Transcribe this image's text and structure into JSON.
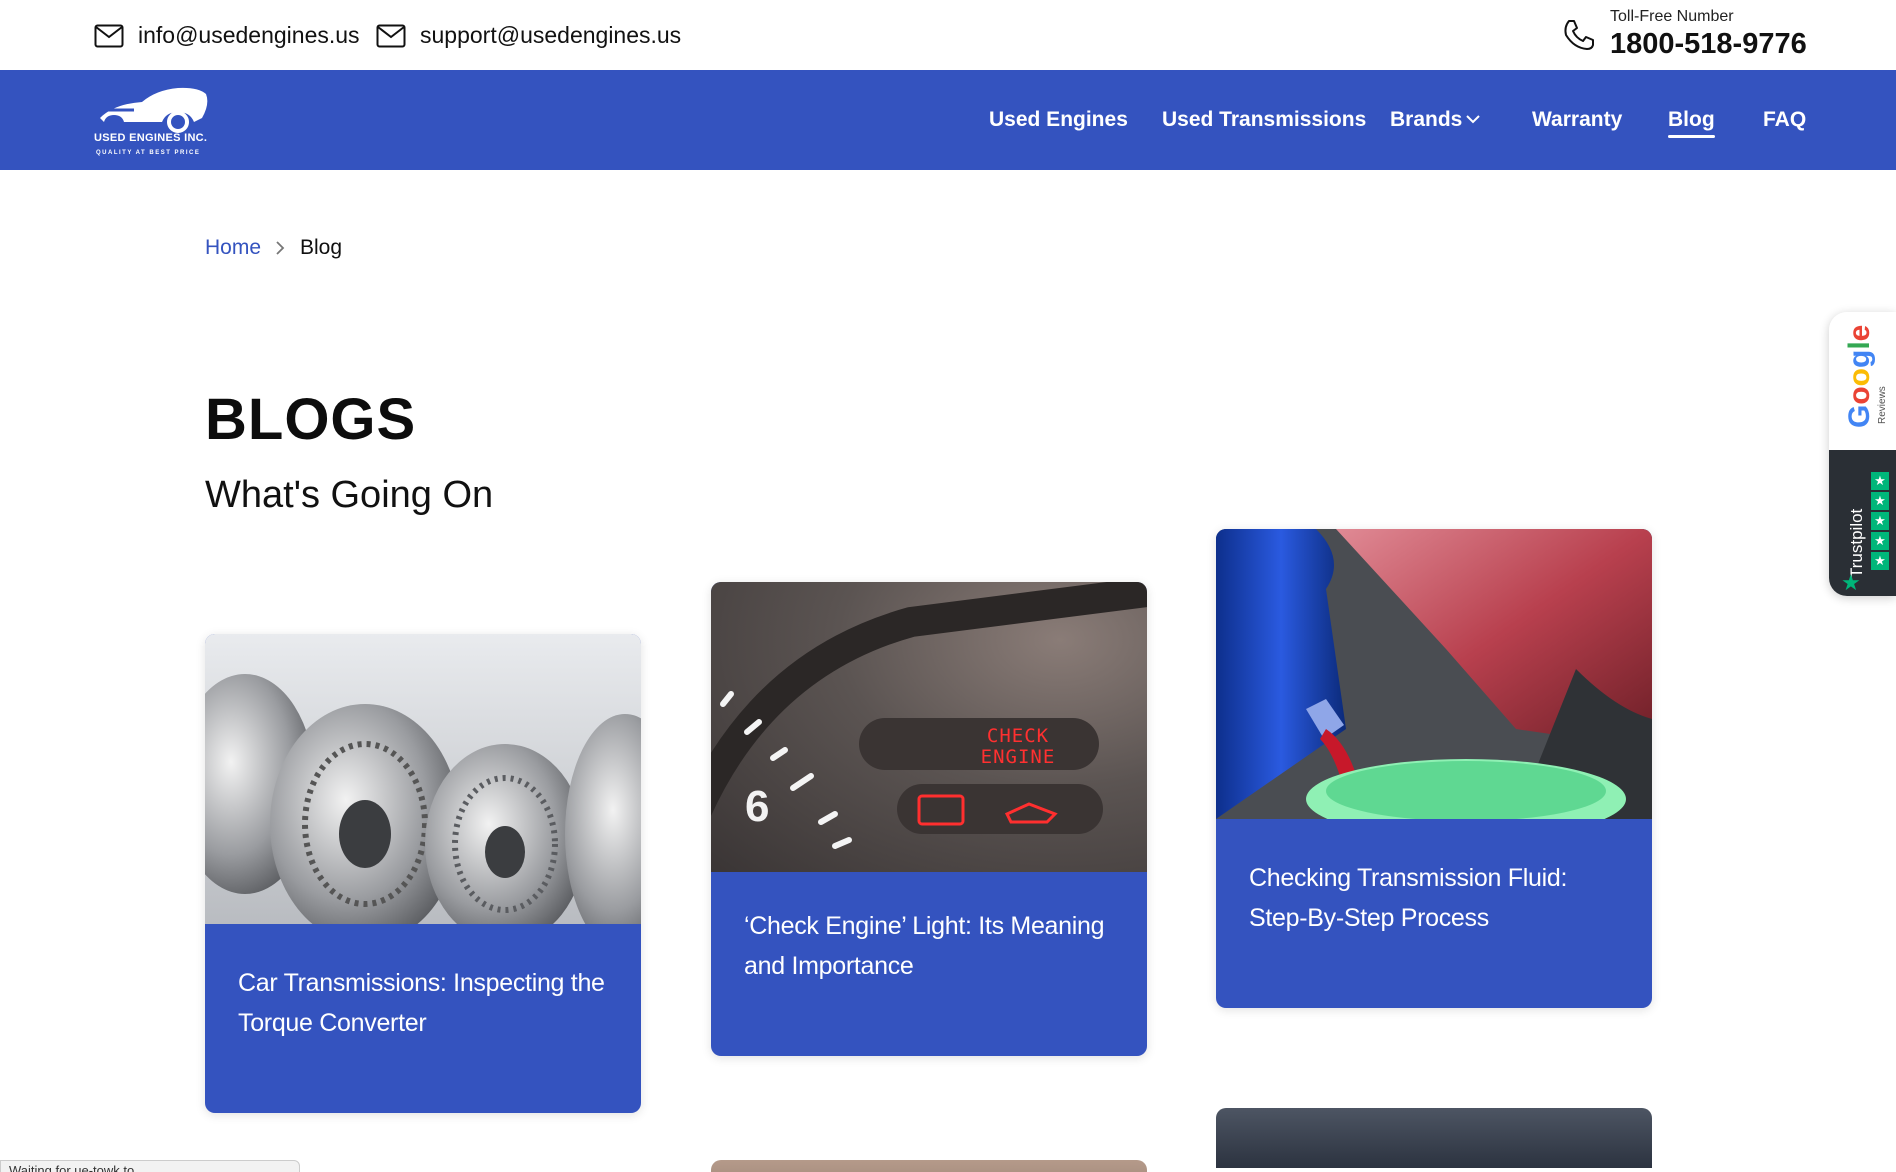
{
  "topbar": {
    "email_info": "info@usedengines.us",
    "email_support": "support@usedengines.us",
    "tollfree_label": "Toll-Free Number",
    "tollfree_number": "1800-518-9776",
    "icons": [
      "mail-icon",
      "mail-icon",
      "phone-icon"
    ]
  },
  "brand": {
    "name": "USED ENGINES INC.",
    "tagline": "QUALITY AT BEST PRICE",
    "nav_color": "#3453bf"
  },
  "nav": {
    "items": [
      {
        "label": "Used Engines"
      },
      {
        "label": "Used Transmissions"
      },
      {
        "label": "Brands"
      },
      {
        "label": "Warranty"
      },
      {
        "label": "Blog",
        "active": true
      },
      {
        "label": "FAQ"
      }
    ]
  },
  "breadcrumb": {
    "home": "Home",
    "current": "Blog"
  },
  "page": {
    "title": "BLOGS",
    "subtitle": "What's Going On"
  },
  "cards": [
    {
      "title": "Car Transmissions: Inspecting the Torque Converter",
      "image": "torque-converters"
    },
    {
      "title": "‘Check Engine’ Light: Its Meaning and Importance",
      "image": "dashboard-check-engine",
      "image_text": "CHECK ENGINE",
      "gauge_number": "6"
    },
    {
      "title": "Checking Transmission Fluid: Step-By-Step Process",
      "image": "pouring-fluid"
    }
  ],
  "reviews_widget": {
    "google": "Google",
    "google_sub": "Reviews",
    "trustpilot": "Trustpilot"
  },
  "status_bar": {
    "text": "Waiting for ue-towk.to..."
  }
}
